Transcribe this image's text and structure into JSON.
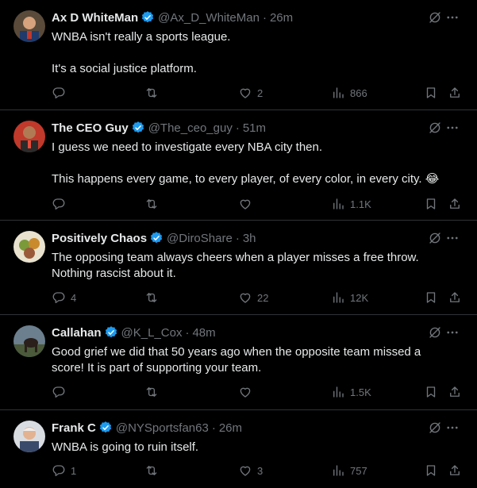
{
  "tweets": [
    {
      "name": "Ax D WhiteMan",
      "handle": "@Ax_D_WhiteMan",
      "time": "26m",
      "lines": [
        "WNBA isn't really a sports league.",
        "It's a social justice platform."
      ],
      "replies": "",
      "retweets": "",
      "likes": "2",
      "views": "866"
    },
    {
      "name": "The CEO Guy",
      "handle": "@The_ceo_guy",
      "time": "51m",
      "lines": [
        "I guess we need to investigate every NBA city then.",
        "This happens every game, to every player, of every color, in every city. 😂"
      ],
      "replies": "",
      "retweets": "",
      "likes": "",
      "views": "1.1K"
    },
    {
      "name": "Positively Chaos",
      "handle": "@DiroShare",
      "time": "3h",
      "lines": [
        "The opposing team always cheers when a player misses a free throw.",
        "Nothing rascist about it."
      ],
      "replies": "4",
      "retweets": "",
      "likes": "22",
      "views": "12K"
    },
    {
      "name": "Callahan",
      "handle": "@K_L_Cox",
      "time": "48m",
      "lines": [
        "Good grief we did that 50 years ago when the opposite team missed a",
        "score!  It is part of supporting your team."
      ],
      "replies": "",
      "retweets": "",
      "likes": "",
      "views": "1.5K"
    },
    {
      "name": "Frank C",
      "handle": "@NYSportsfan63",
      "time": "26m",
      "lines": [
        "WNBA is going to ruin itself."
      ],
      "replies": "1",
      "retweets": "",
      "likes": "3",
      "views": "757"
    }
  ],
  "icons": {
    "reply": "reply-icon",
    "retweet": "retweet-icon",
    "like": "heart-icon",
    "views": "views-icon",
    "bookmark": "bookmark-icon",
    "share": "share-icon",
    "grok": "grok-icon",
    "more": "more-icon",
    "verified": "verified-badge-icon"
  },
  "colors": {
    "background": "#000000",
    "text": "#e7e9ea",
    "muted": "#71767b",
    "divider": "#2f3336",
    "verified": "#1d9bf0"
  }
}
